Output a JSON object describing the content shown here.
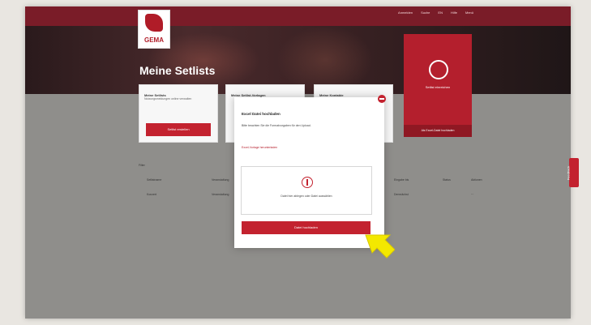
{
  "header": {
    "logo_text": "GEMA",
    "nav": [
      "Anmelden",
      "Suche",
      "EN",
      "Hilfe",
      "Menü"
    ]
  },
  "page": {
    "title": "Meine Setlists"
  },
  "cards": [
    {
      "title": "Meine Setlists",
      "desc": "Nutzungsmeldungen online verwalten",
      "button": "Setlist erstellen"
    },
    {
      "title": "Meine Setlist-Vorlagen",
      "desc": ""
    },
    {
      "title": "Meine Kontakte",
      "desc": ""
    }
  ],
  "promo": {
    "text": "Setlist einreichen",
    "button": "Als Excel-Datei hochladen"
  },
  "table": {
    "filter": "Filter",
    "columns": [
      "Setlistname",
      "Veranstaltung",
      "Eingabe bis",
      "Status",
      "Aktionen"
    ],
    "row": [
      "Konzert",
      "Veranstaltung",
      "Demnächst",
      "",
      "⋯"
    ]
  },
  "modal": {
    "title": "Excel Datei hochladen",
    "desc": "Bitte beachten Sie die Formatvorgaben für den Upload.",
    "link": "Excel-Vorlage herunterladen",
    "drop_text": "Datei hier ablegen oder Datei auswählen",
    "upload_button": "Datei hochladen"
  },
  "feedback": {
    "label": "Feedback"
  }
}
